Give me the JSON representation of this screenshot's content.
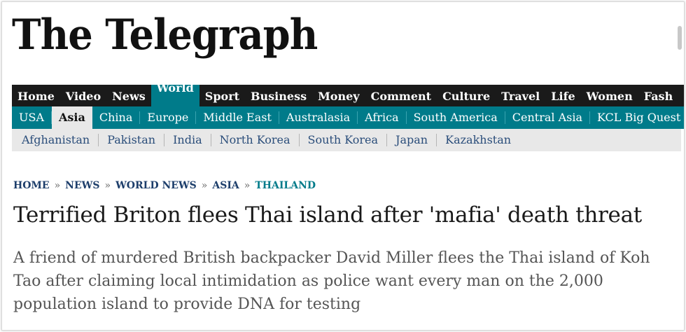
{
  "masthead": {
    "title": "The Telegraph"
  },
  "nav_primary": [
    {
      "label": "Home",
      "active": false
    },
    {
      "label": "Video",
      "active": false
    },
    {
      "label": "News",
      "active": false
    },
    {
      "label": "World",
      "active": true
    },
    {
      "label": "Sport",
      "active": false
    },
    {
      "label": "Business",
      "active": false
    },
    {
      "label": "Money",
      "active": false
    },
    {
      "label": "Comment",
      "active": false
    },
    {
      "label": "Culture",
      "active": false
    },
    {
      "label": "Travel",
      "active": false
    },
    {
      "label": "Life",
      "active": false
    },
    {
      "label": "Women",
      "active": false
    },
    {
      "label": "Fash",
      "active": false
    }
  ],
  "nav_secondary": [
    {
      "label": "USA",
      "active": false
    },
    {
      "label": "Asia",
      "active": true
    },
    {
      "label": "China",
      "active": false
    },
    {
      "label": "Europe",
      "active": false
    },
    {
      "label": "Middle East",
      "active": false
    },
    {
      "label": "Australasia",
      "active": false
    },
    {
      "label": "Africa",
      "active": false
    },
    {
      "label": "South America",
      "active": false
    },
    {
      "label": "Central Asia",
      "active": false
    },
    {
      "label": "KCL Big Quest",
      "active": false
    }
  ],
  "nav_tertiary": [
    {
      "label": "Afghanistan"
    },
    {
      "label": "Pakistan"
    },
    {
      "label": "India"
    },
    {
      "label": "North Korea"
    },
    {
      "label": "South Korea"
    },
    {
      "label": "Japan"
    },
    {
      "label": "Kazakhstan"
    }
  ],
  "breadcrumb": [
    {
      "label": "HOME",
      "current": false
    },
    {
      "label": "NEWS",
      "current": false
    },
    {
      "label": "WORLD NEWS",
      "current": false
    },
    {
      "label": "ASIA",
      "current": false
    },
    {
      "label": "THAILAND",
      "current": true
    }
  ],
  "breadcrumb_separator": "»",
  "article": {
    "headline": "Terrified Briton flees Thai island after 'mafia' death threat",
    "standfirst": "A friend of murdered British backpacker David Miller flees the Thai island of Koh Tao after claiming local intimidation as police want every man on the 2,000 population island to provide DNA for testing"
  },
  "colors": {
    "accent_teal": "#007b8a",
    "nav_dark": "#1a1a1a",
    "subnav_grey": "#e8e8e8",
    "link_blue": "#1d3e6b"
  }
}
